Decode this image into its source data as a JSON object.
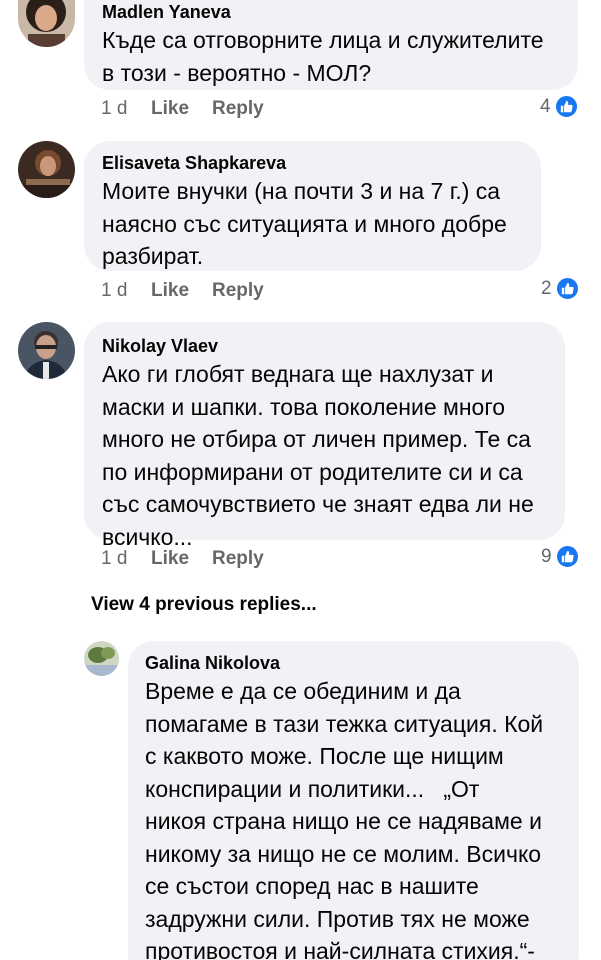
{
  "colors": {
    "bubble": "#f0f2f5",
    "meta": "#65676b",
    "accent": "#1877f2"
  },
  "comments": [
    {
      "author": "Madlen Yaneva",
      "text": "Къде са отговорните лица и служителите\nв този - вероятно - МОЛ?",
      "time": "1 d",
      "like_label": "Like",
      "reply_label": "Reply",
      "likes": "4"
    },
    {
      "author": "Elisaveta Shapkareva",
      "text": "Моите внучки (на почти 3 и на 7 г.) са\nнаясно със ситуацията и много добре\nразбират.",
      "time": "1 d",
      "like_label": "Like",
      "reply_label": "Reply",
      "likes": "2"
    },
    {
      "author": "Nikolay Vlaev",
      "text": "Ако ги глобят веднага ще нахлузат и\nмаски и шапки. това поколение много\nмного не отбира от личен пример. Те са\nпо информирани от родителите си и са\nсъс самочувствието че знаят едва ли не\nвсичко...",
      "time": "1 d",
      "like_label": "Like",
      "reply_label": "Reply",
      "likes": "9"
    }
  ],
  "view_previous": "View 4 previous replies...",
  "reply": {
    "author": "Galina Nikolova",
    "text": "Време е да се обединим и да\nпомагаме в тази тежка ситуация. Кой\nс каквото може. После ще нищим\nконспирации и политики...   „От\nникоя страна нищо не се надяваме и\nникому за нищо не се молим. Всичко\nсе състои според нас в нашите\nзадружни сили. Против тях не може\nпротивостоя и най-силната стихия.“-\nВасил Левски."
  }
}
